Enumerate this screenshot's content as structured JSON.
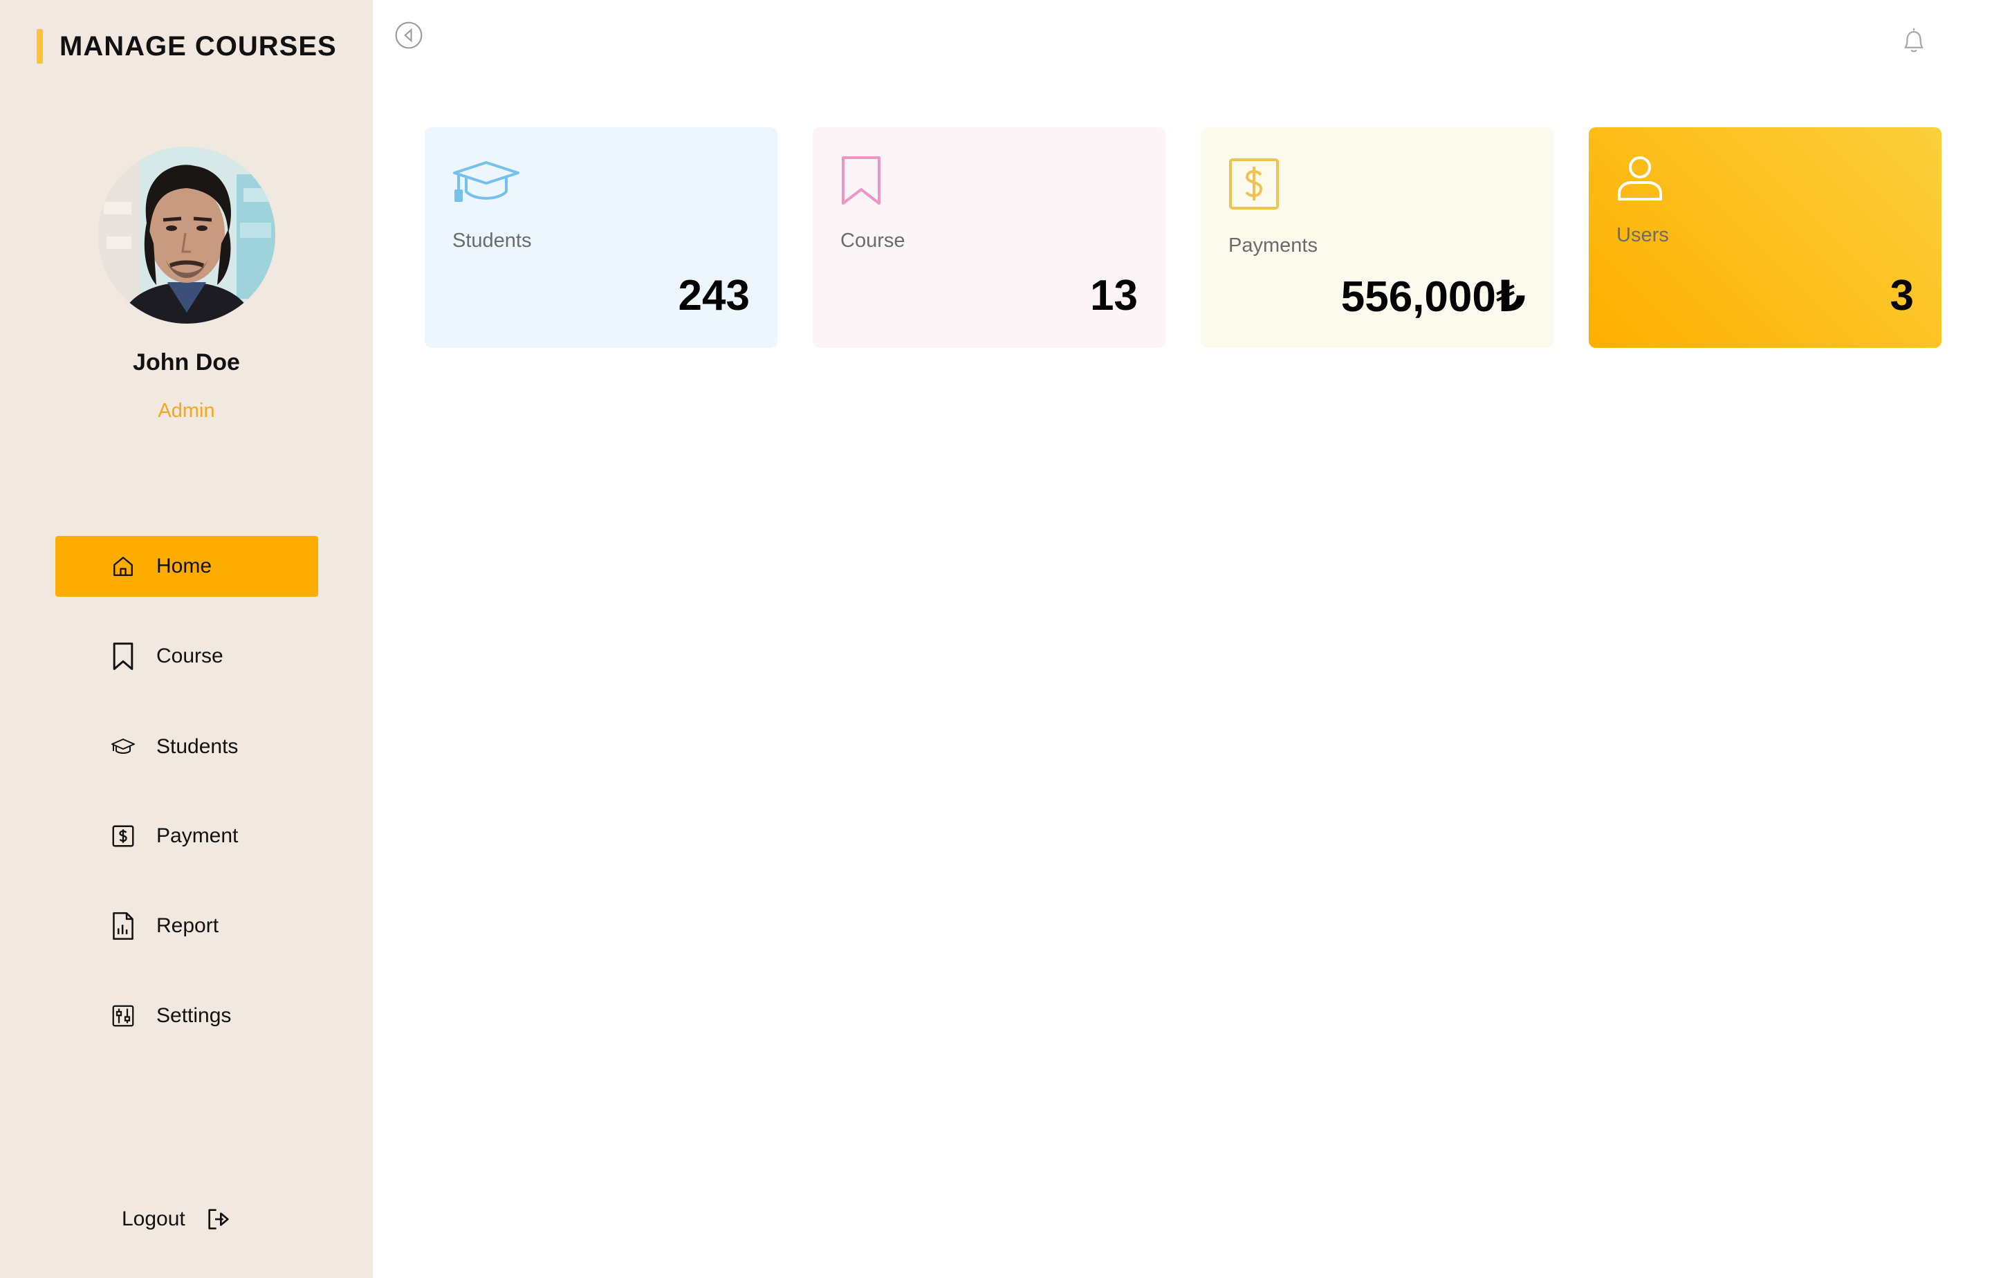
{
  "app": {
    "title": "MANAGE COURSES"
  },
  "user": {
    "name": "John Doe",
    "role": "Admin"
  },
  "nav": {
    "items": [
      {
        "label": "Home",
        "icon": "home-icon",
        "active": true
      },
      {
        "label": "Course",
        "icon": "bookmark-icon",
        "active": false
      },
      {
        "label": "Students",
        "icon": "graduation-cap-icon",
        "active": false
      },
      {
        "label": "Payment",
        "icon": "dollar-icon",
        "active": false
      },
      {
        "label": "Report",
        "icon": "report-icon",
        "active": false
      },
      {
        "label": "Settings",
        "icon": "settings-icon",
        "active": false
      }
    ],
    "logout_label": "Logout"
  },
  "stats": [
    {
      "label": "Students",
      "value": "243",
      "icon": "graduation-cap-icon",
      "color": "#74c1ed"
    },
    {
      "label": "Course",
      "value": "13",
      "icon": "bookmark-icon",
      "color": "#ee95c5"
    },
    {
      "label": "Payments",
      "value": "556,000₺",
      "icon": "dollar-icon",
      "color": "#f0c24f"
    },
    {
      "label": "Users",
      "value": "3",
      "icon": "user-icon",
      "color": "#ffffff"
    }
  ],
  "colors": {
    "accent": "#feac00",
    "sidebar_bg": "#f1e8df",
    "brand_bar": "#fec23a",
    "role_text": "#f5a623"
  }
}
